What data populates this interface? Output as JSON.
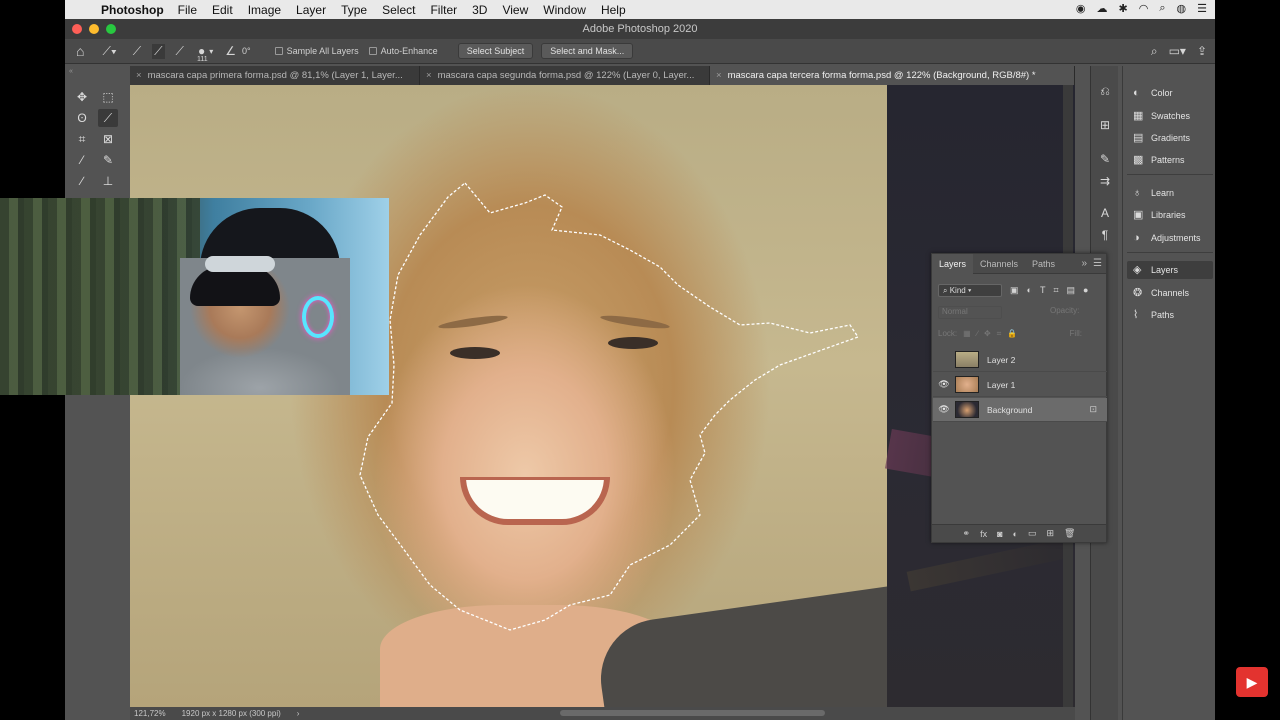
{
  "menubar": {
    "app_name": "Photoshop",
    "items": [
      "File",
      "Edit",
      "Image",
      "Layer",
      "Type",
      "Select",
      "Filter",
      "3D",
      "View",
      "Window",
      "Help"
    ]
  },
  "window": {
    "title": "Adobe Photoshop 2020"
  },
  "options": {
    "brush_size": "111",
    "angle": "0°",
    "sample_all_layers": "Sample All Layers",
    "auto_enhance": "Auto-Enhance",
    "select_subject": "Select Subject",
    "select_and_mask": "Select and Mask..."
  },
  "tabs": [
    {
      "label": "mascara capa primera forma.psd @ 81,1% (Layer 1, Layer...",
      "active": false
    },
    {
      "label": "mascara capa segunda forma.psd @ 122% (Layer 0, Layer...",
      "active": false
    },
    {
      "label": "mascara capa tercera forma forma.psd @ 122% (Background, RGB/8#) *",
      "active": true
    }
  ],
  "status": {
    "zoom": "121,72%",
    "doc_info": "1920 px x 1280 px (300 ppi)",
    "arrow": "›"
  },
  "right_panel": {
    "items": [
      {
        "label": "Color",
        "icon": "color-icon"
      },
      {
        "label": "Swatches",
        "icon": "swatches-icon"
      },
      {
        "label": "Gradients",
        "icon": "gradients-icon"
      },
      {
        "label": "Patterns",
        "icon": "patterns-icon"
      },
      {
        "label": "Learn",
        "icon": "learn-icon"
      },
      {
        "label": "Libraries",
        "icon": "libraries-icon"
      },
      {
        "label": "Adjustments",
        "icon": "adjustments-icon"
      },
      {
        "label": "Layers",
        "icon": "layers-icon"
      },
      {
        "label": "Channels",
        "icon": "channels-icon"
      },
      {
        "label": "Paths",
        "icon": "paths-icon"
      }
    ]
  },
  "layers_panel": {
    "tabs": [
      "Layers",
      "Channels",
      "Paths"
    ],
    "filter_kind": "Kind",
    "blend_mode": "Normal",
    "opacity_label": "Opacity:",
    "lock_label": "Lock:",
    "fill_label": "Fill:",
    "layers": [
      {
        "name": "Layer 2",
        "visible": false,
        "locked": false,
        "selected": false
      },
      {
        "name": "Layer 1",
        "visible": true,
        "locked": false,
        "selected": false
      },
      {
        "name": "Background",
        "visible": true,
        "locked": true,
        "selected": true
      }
    ]
  },
  "colors": {
    "accent": "#e3332f",
    "panel": "#535353",
    "dark": "#3a3a3a"
  }
}
